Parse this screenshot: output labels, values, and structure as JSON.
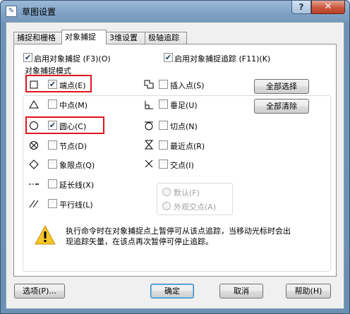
{
  "window": {
    "title": "草图设置",
    "help_glyph": "?",
    "close_glyph": "✕",
    "app_icon_glyph": "✎"
  },
  "tabs": [
    "捕捉和栅格",
    "对象捕捉",
    "3维设置",
    "极轴追踪"
  ],
  "top_options": {
    "osnap_on": {
      "label": "启用对象捕捉 (F3)(O)",
      "checked": true
    },
    "otrack_on": {
      "label": "启用对象捕捉追踪 (F11)(K)",
      "checked": true
    }
  },
  "group_title": "对象捕捉模式",
  "left_modes": [
    {
      "label": "端点(E)",
      "checked": true,
      "icon": "square-icon"
    },
    {
      "label": "中点(M)",
      "checked": false,
      "icon": "triangle-icon"
    },
    {
      "label": "圆心(C)",
      "checked": true,
      "icon": "circle-icon"
    },
    {
      "label": "节点(D)",
      "checked": false,
      "icon": "node-icon"
    },
    {
      "label": "象限点(Q)",
      "checked": false,
      "icon": "diamond-icon"
    },
    {
      "label": "延长线(X)",
      "checked": false,
      "icon": "extension-icon"
    },
    {
      "label": "平行线(L)",
      "checked": false,
      "icon": "parallel-icon"
    }
  ],
  "right_modes": [
    {
      "label": "插入点(S)",
      "checked": false,
      "icon": "insert-icon"
    },
    {
      "label": "垂足(U)",
      "checked": false,
      "icon": "perpendicular-icon"
    },
    {
      "label": "切点(N)",
      "checked": false,
      "icon": "tangent-icon"
    },
    {
      "label": "最近点(R)",
      "checked": false,
      "icon": "nearest-icon"
    },
    {
      "label": "交点(I)",
      "checked": false,
      "icon": "intersection-icon"
    }
  ],
  "buttons_right": {
    "select_all": "全部选择",
    "clear_all": "全部清除"
  },
  "radios": [
    {
      "label": "默认(F)",
      "enabled": false
    },
    {
      "label": "外观交点(A)",
      "enabled": false
    }
  ],
  "hint": {
    "icon": "warning-icon",
    "line1": "执行命令时在对象捕捉点上暂停可从该点追踪，当移动光标时会出",
    "line2": "现追踪矢量，在该点再次暂停可停止追踪。"
  },
  "bottom_buttons": {
    "options": "选项(P)...",
    "ok": "确定",
    "cancel": "取消",
    "help": "帮助(H)"
  },
  "colors": {
    "highlight_box": "#e0141e",
    "check": "#1b3d69"
  }
}
